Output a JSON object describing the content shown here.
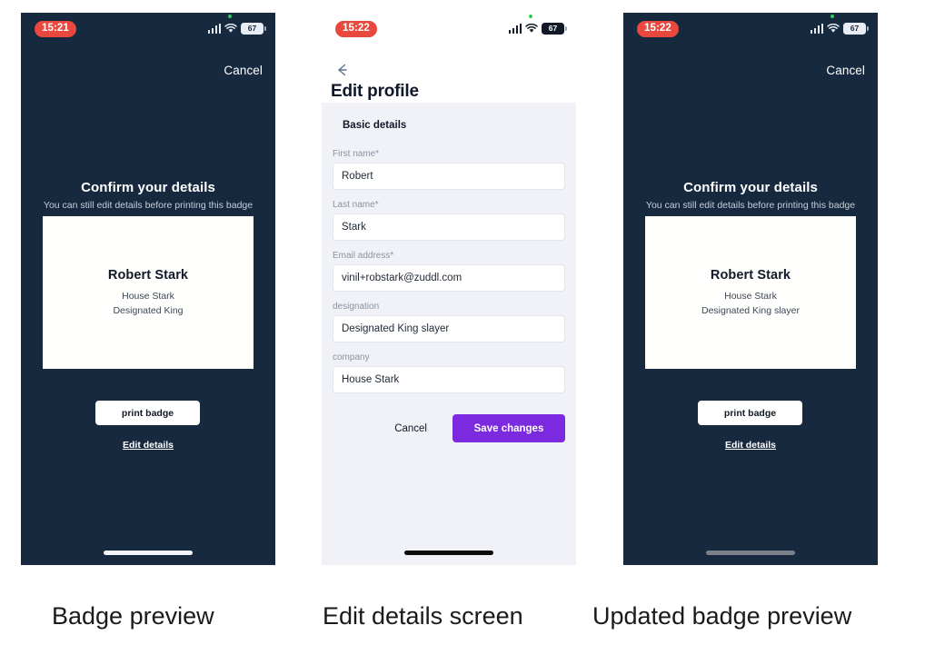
{
  "captions": {
    "badge_preview": "Badge preview",
    "edit_screen": "Edit details screen",
    "updated_preview": "Updated badge preview"
  },
  "colors": {
    "navy": "#17293f",
    "purple": "#7c2ae0",
    "red_pill": "#e8483e",
    "form_bg": "#f0f2f7",
    "green_dot": "#34c759"
  },
  "phone1": {
    "status": {
      "time": "15:21",
      "battery": "67",
      "signal_icon": "cellular-signal-icon",
      "wifi_icon": "wifi-icon",
      "battery_icon": "battery-icon",
      "recording_dot_icon": "green-status-dot-icon"
    },
    "cancel_label": "Cancel",
    "title": "Confirm your details",
    "subtitle": "You can still edit details before printing this badge",
    "badge": {
      "name": "Robert Stark",
      "company": "House Stark",
      "designation": "Designated King"
    },
    "print_label": "print badge",
    "edit_label": "Edit details"
  },
  "phone2": {
    "status": {
      "time": "15:22",
      "battery": "67",
      "signal_icon": "cellular-signal-icon",
      "wifi_icon": "wifi-icon",
      "battery_icon": "battery-icon",
      "recording_dot_icon": "green-status-dot-icon"
    },
    "back_icon": "back-arrow-icon",
    "heading": "Edit profile",
    "section_title": "Basic details",
    "fields": [
      {
        "label": "First name*",
        "value": "Robert"
      },
      {
        "label": "Last name*",
        "value": "Stark"
      },
      {
        "label": "Email address*",
        "value": "vinil+robstark@zuddl.com"
      },
      {
        "label": "designation",
        "value": "Designated King slayer"
      },
      {
        "label": "company",
        "value": "House Stark"
      }
    ],
    "cancel_label": "Cancel",
    "save_label": "Save changes"
  },
  "phone3": {
    "status": {
      "time": "15:22",
      "battery": "67",
      "signal_icon": "cellular-signal-icon",
      "wifi_icon": "wifi-icon",
      "battery_icon": "battery-icon",
      "recording_dot_icon": "green-status-dot-icon"
    },
    "cancel_label": "Cancel",
    "title": "Confirm your details",
    "subtitle": "You can still edit details before printing this badge",
    "badge": {
      "name": "Robert Stark",
      "company": "House Stark",
      "designation": "Designated King slayer"
    },
    "print_label": "print badge",
    "edit_label": "Edit details"
  }
}
